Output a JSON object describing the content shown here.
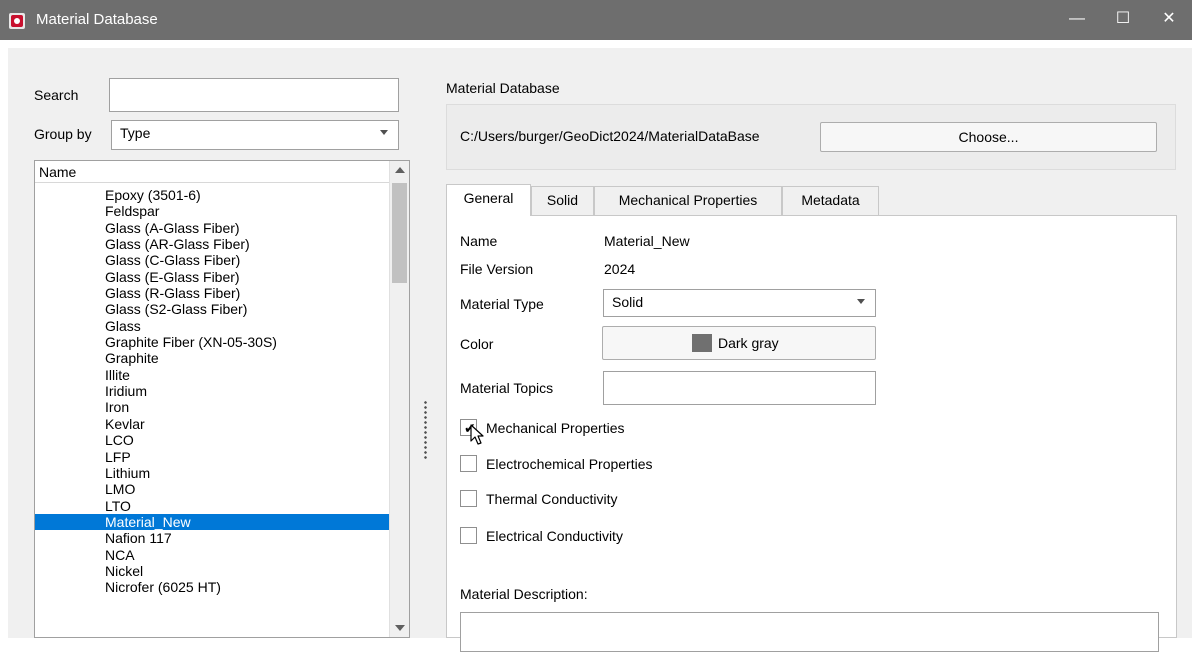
{
  "window": {
    "title": "Material Database",
    "minimize": "—",
    "maximize": "☐",
    "close": "✕"
  },
  "left": {
    "search_label": "Search",
    "search_value": "",
    "groupby_label": "Group by",
    "groupby_value": "Type",
    "list_header": "Name",
    "items": [
      "Epoxy (3501-6)",
      "Feldspar",
      "Glass (A-Glass Fiber)",
      "Glass (AR-Glass Fiber)",
      "Glass (C-Glass Fiber)",
      "Glass (E-Glass Fiber)",
      "Glass (R-Glass Fiber)",
      "Glass (S2-Glass Fiber)",
      "Glass",
      "Graphite Fiber (XN-05-30S)",
      "Graphite",
      "Illite",
      "Iridium",
      "Iron",
      "Kevlar",
      "LCO",
      "LFP",
      "Lithium",
      "LMO",
      "LTO",
      "Material_New",
      "Nafion 117",
      "NCA",
      "Nickel",
      "Nicrofer (6025 HT)"
    ],
    "selected_index": 20
  },
  "right": {
    "section_label": "Material Database",
    "path": "C:/Users/burger/GeoDict2024/MaterialDataBase",
    "choose_button": "Choose...",
    "tabs": [
      {
        "label": "General",
        "active": true
      },
      {
        "label": "Solid",
        "active": false
      },
      {
        "label": "Mechanical Properties",
        "active": false
      },
      {
        "label": "Metadata",
        "active": false
      }
    ],
    "general": {
      "name_label": "Name",
      "name_value": "Material_New",
      "version_label": "File Version",
      "version_value": "2024",
      "type_label": "Material Type",
      "type_value": "Solid",
      "color_label": "Color",
      "color_value": "Dark gray",
      "color_swatch": "#707070",
      "topics_label": "Material Topics",
      "topics_value": "",
      "checkboxes": [
        {
          "label": "Mechanical Properties",
          "checked": true
        },
        {
          "label": "Electrochemical Properties",
          "checked": false
        },
        {
          "label": "Thermal Conductivity",
          "checked": false
        },
        {
          "label": "Electrical Conductivity",
          "checked": false
        }
      ],
      "description_label": "Material Description:",
      "description_value": ""
    }
  },
  "colors": {
    "selection": "#0078d7",
    "titlebar": "#6e6e6e",
    "app_icon": "#c8102e"
  }
}
